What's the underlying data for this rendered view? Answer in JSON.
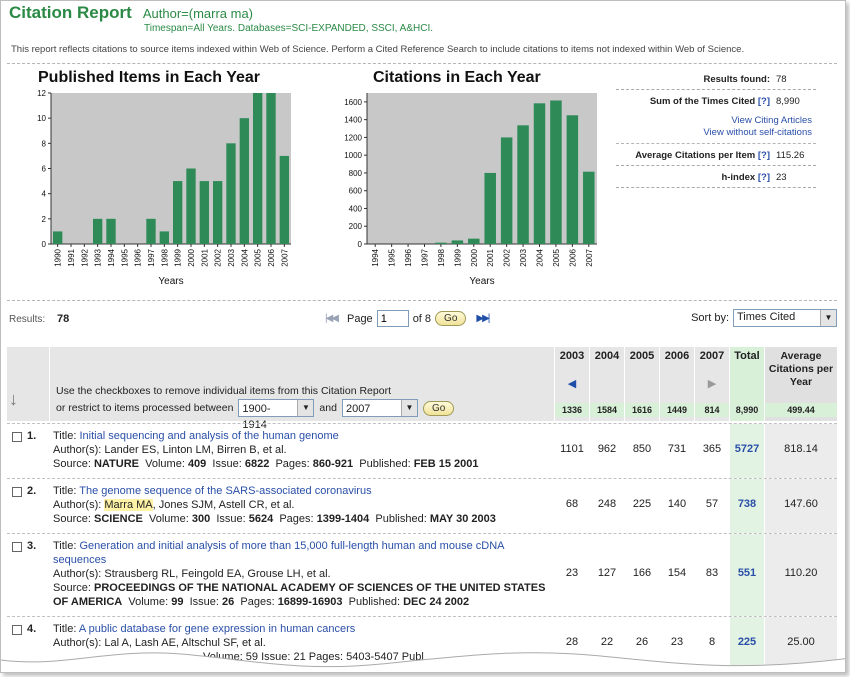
{
  "header": {
    "title": "Citation Report",
    "query": "Author=(marra ma)",
    "timespan": "Timespan=All Years. Databases=SCI-EXPANDED, SSCI, A&HCI.",
    "disclaimer": "This report reflects citations to source items indexed within Web of Science. Perform a Cited Reference Search to include citations to items not indexed within Web of Science."
  },
  "chart_data": [
    {
      "type": "bar",
      "title": "Published Items in Each Year",
      "xlabel": "Years",
      "ylabel": "",
      "categories": [
        "1990",
        "1991",
        "1992",
        "1993",
        "1994",
        "1995",
        "1996",
        "1997",
        "1998",
        "1999",
        "2000",
        "2001",
        "2002",
        "2003",
        "2004",
        "2005",
        "2006",
        "2007"
      ],
      "values": [
        1,
        0,
        0,
        2,
        2,
        0,
        0,
        2,
        1,
        5,
        6,
        5,
        5,
        8,
        10,
        12,
        12,
        7
      ],
      "ylim": [
        0,
        12
      ],
      "yticks": [
        0,
        2,
        4,
        6,
        8,
        10,
        12
      ],
      "color": "#2e8b57",
      "grid": false
    },
    {
      "type": "bar",
      "title": "Citations in Each Year",
      "xlabel": "Years",
      "ylabel": "",
      "categories": [
        "1994",
        "1995",
        "1996",
        "1997",
        "1998",
        "1999",
        "2000",
        "2001",
        "2002",
        "2003",
        "2004",
        "2005",
        "2006",
        "2007"
      ],
      "values": [
        0,
        0,
        0,
        0,
        15,
        40,
        60,
        800,
        1200,
        1336,
        1584,
        1616,
        1449,
        814
      ],
      "ylim": [
        0,
        1700
      ],
      "yticks": [
        0,
        200,
        400,
        600,
        800,
        1000,
        1200,
        1400,
        1600
      ],
      "color": "#2e8b57",
      "grid": false
    }
  ],
  "stats": {
    "results_found_label": "Results found:",
    "results_found": "78",
    "sum_label": "Sum of the Times Cited",
    "sum_help": "[?]",
    "sum_value": "8,990",
    "view_citing": "View Citing Articles",
    "view_without": "View without self-citations",
    "avg_label": "Average Citations per Item",
    "avg_help": "[?]",
    "avg_value": "115.26",
    "h_label": "h-index",
    "h_help": "[?]",
    "h_value": "23"
  },
  "toolbar": {
    "results_label": "Results:",
    "results_count": "78",
    "page_label": "Page",
    "page_value": "1",
    "of_label": "of 8",
    "go_label": "Go",
    "sort_label": "Sort by:",
    "sort_value": "Times Cited"
  },
  "table": {
    "instructions": "Use the checkboxes to remove individual items from this Citation Report",
    "restrict_label": "or restrict to items processed between",
    "range_from": "1900-1914",
    "and_label": "and",
    "range_to": "2007",
    "go_label": "Go",
    "columns": [
      {
        "year": "2003",
        "sum": "1336"
      },
      {
        "year": "2004",
        "sum": "1584"
      },
      {
        "year": "2005",
        "sum": "1616"
      },
      {
        "year": "2006",
        "sum": "1449"
      },
      {
        "year": "2007",
        "sum": "814"
      }
    ],
    "total_header": "Total",
    "total_sum": "8,990",
    "avg_header": "Average Citations per Year",
    "avg_sum": "499.44",
    "records": [
      {
        "num": "1.",
        "title_label": "Title:",
        "title": "Initial sequencing and analysis of the human genome",
        "authors_label": "Author(s):",
        "authors": "Lander ES, Linton LM, Birren B, et al.",
        "source_label": "Source:",
        "source": "NATURE",
        "volume_label": "Volume:",
        "volume": "409",
        "issue_label": "Issue:",
        "issue": "6822",
        "pages_label": "Pages:",
        "pages": "860-921",
        "published_label": "Published:",
        "published": "FEB 15 2001",
        "counts": [
          "1101",
          "962",
          "850",
          "731",
          "365"
        ],
        "total": "5727",
        "avg": "818.14"
      },
      {
        "num": "2.",
        "title_label": "Title:",
        "title": "The genome sequence of the SARS-associated coronavirus",
        "authors_label": "Author(s):",
        "authors_hl": "Marra MA",
        "authors_rest": ", Jones SJM, Astell CR, et al.",
        "source_label": "Source:",
        "source": "SCIENCE",
        "volume_label": "Volume:",
        "volume": "300",
        "issue_label": "Issue:",
        "issue": "5624",
        "pages_label": "Pages:",
        "pages": "1399-1404",
        "published_label": "Published:",
        "published": "MAY 30 2003",
        "counts": [
          "68",
          "248",
          "225",
          "140",
          "57"
        ],
        "total": "738",
        "avg": "147.60"
      },
      {
        "num": "3.",
        "title_label": "Title:",
        "title": "Generation and initial analysis of more than 15,000 full-length human and mouse cDNA sequences",
        "authors_label": "Author(s):",
        "authors": "Strausberg RL, Feingold EA, Grouse LH, et al.",
        "source_label": "Source:",
        "source": "PROCEEDINGS OF THE NATIONAL ACADEMY OF SCIENCES OF THE UNITED STATES OF AMERICA",
        "volume_label": "Volume:",
        "volume": "99",
        "issue_label": "Issue:",
        "issue": "26",
        "pages_label": "Pages:",
        "pages": "16899-16903",
        "published_label": "Published:",
        "published": "DEC 24 2002",
        "counts": [
          "23",
          "127",
          "166",
          "154",
          "83"
        ],
        "total": "551",
        "avg": "110.20"
      },
      {
        "num": "4.",
        "title_label": "Title:",
        "title": "A public database for gene expression in human cancers",
        "authors_label": "Author(s):",
        "authors": "Lal A, Lash AE, Altschul SF, et al.",
        "source_partial": "Volume: 59   Issue: 21   Pages: 5403-5407   Publ",
        "counts": [
          "28",
          "22",
          "26",
          "23",
          "8"
        ],
        "total": "225",
        "avg": "25.00"
      }
    ]
  }
}
